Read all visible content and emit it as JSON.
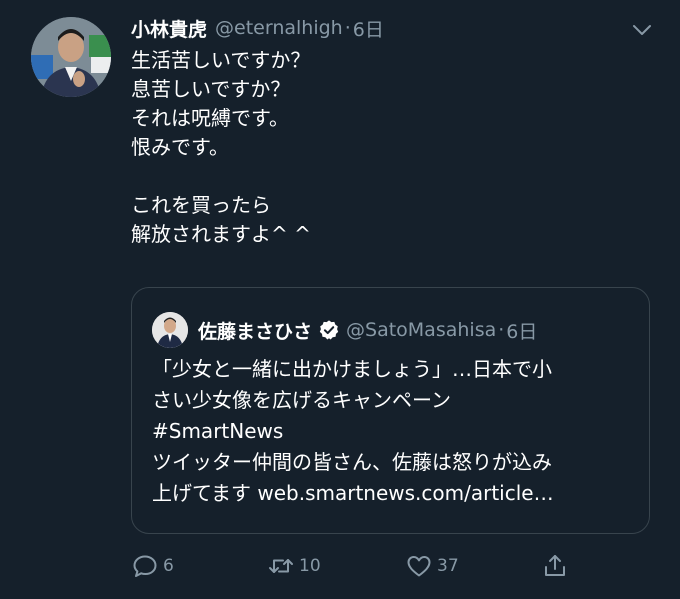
{
  "tweet": {
    "display_name": "小林貴虎",
    "handle": "@eternalhigh",
    "separator": "·",
    "time": "6日",
    "body_lines": [
      "生活苦しいですか？",
      "息苦しいですか？",
      "それは呪縛です。",
      "恨みです。",
      "",
      "これを買ったら",
      "解放されますよ^ ^"
    ]
  },
  "quoted": {
    "display_name": "佐藤まさひさ",
    "handle": "@SatoMasahisa",
    "separator": "·",
    "time": "6日",
    "verified": true,
    "body_lines": [
      "「少女と一緒に出かけましょう」…日本で小",
      "さい少女像を広げるキャンペーン",
      "#SmartNews",
      "ツイッター仲間の皆さん、佐藤は怒りが込み",
      "上げてます web.smartnews.com/article…"
    ]
  },
  "actions": {
    "reply_count": "6",
    "retweet_count": "10",
    "like_count": "37"
  },
  "icons": {
    "caret": "chevron-down-icon",
    "reply": "comment-icon",
    "retweet": "retweet-icon",
    "like": "heart-icon",
    "share": "share-icon",
    "verified": "verified-badge-icon"
  },
  "colors": {
    "background": "#15202b",
    "text": "#ffffff",
    "secondary_text": "#8899a6",
    "border": "#38444d",
    "verified_badge": "#ffffff"
  }
}
